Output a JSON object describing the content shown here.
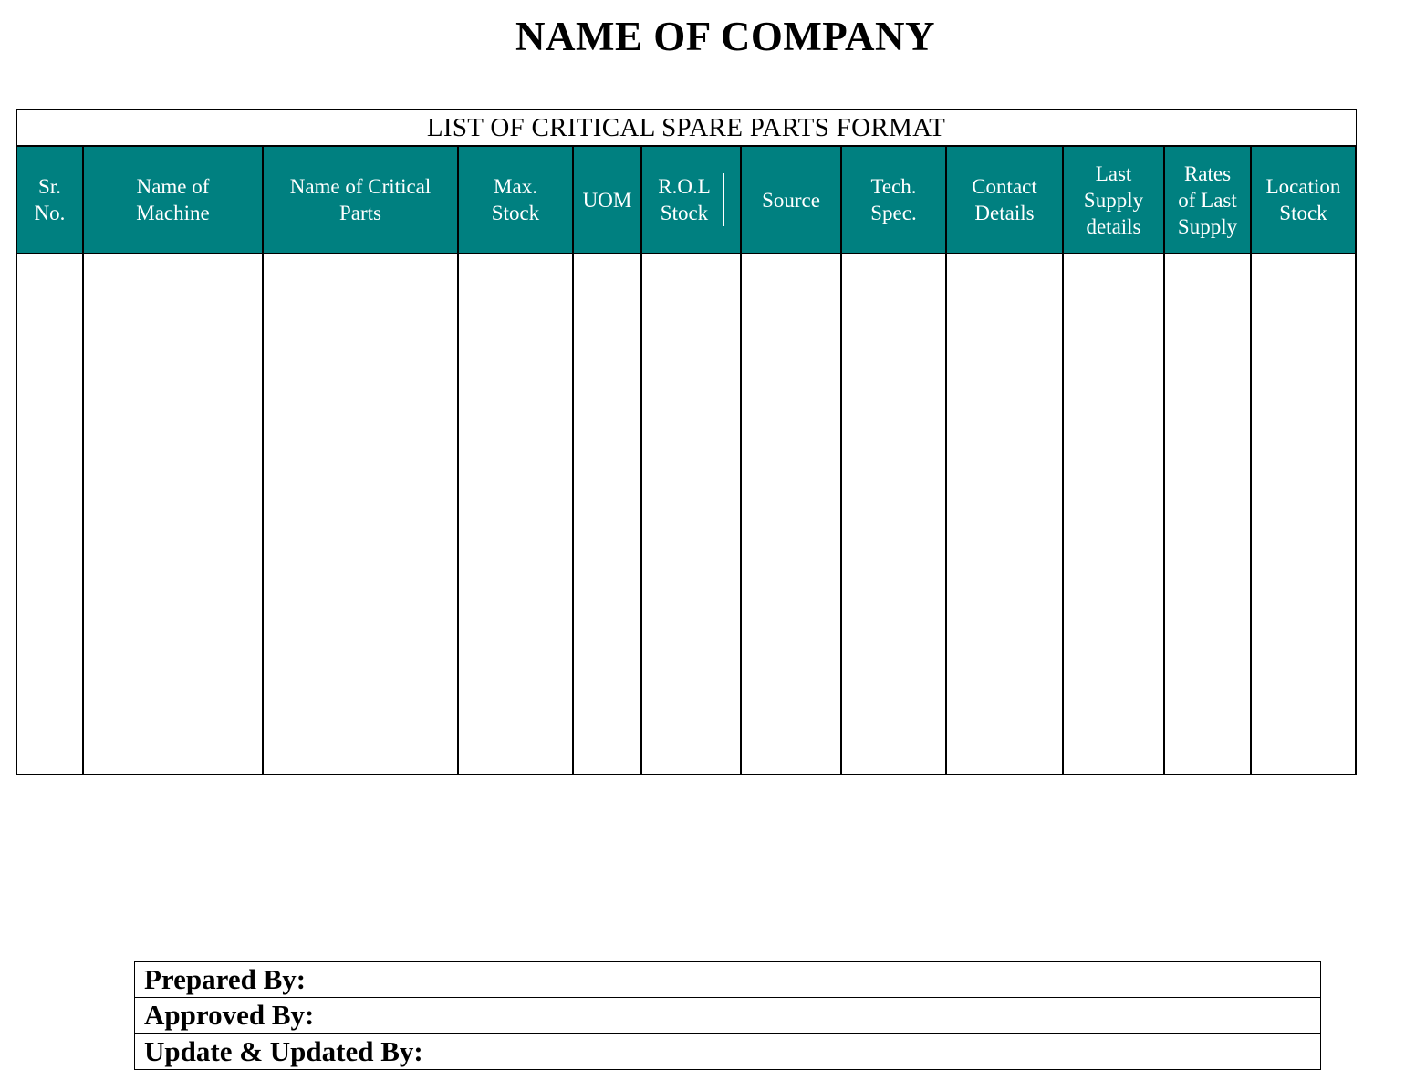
{
  "document": {
    "company_name": "NAME OF COMPANY",
    "table_title": "LIST OF CRITICAL SPARE PARTS FORMAT"
  },
  "table": {
    "columns": [
      {
        "line1": "Sr.",
        "line2": "No.",
        "line3": ""
      },
      {
        "line1": "Name of",
        "line2": "Machine",
        "line3": ""
      },
      {
        "line1": "Name of Critical",
        "line2": "Parts",
        "line3": ""
      },
      {
        "line1": "Max.",
        "line2": "Stock",
        "line3": ""
      },
      {
        "line1": "UOM",
        "line2": "",
        "line3": ""
      },
      {
        "line1": "R.O.L",
        "line2": "Stock",
        "line3": ""
      },
      {
        "line1": "Source",
        "line2": "",
        "line3": ""
      },
      {
        "line1": "Tech.",
        "line2": "Spec.",
        "line3": ""
      },
      {
        "line1": "Contact",
        "line2": "Details",
        "line3": ""
      },
      {
        "line1": "Last",
        "line2": "Supply",
        "line3": "details"
      },
      {
        "line1": "Rates",
        "line2": "of Last",
        "line3": "Supply"
      },
      {
        "line1": "Location",
        "line2": "Stock",
        "line3": ""
      }
    ],
    "rows": [
      [
        "",
        "",
        "",
        "",
        "",
        "",
        "",
        "",
        "",
        "",
        "",
        ""
      ],
      [
        "",
        "",
        "",
        "",
        "",
        "",
        "",
        "",
        "",
        "",
        "",
        ""
      ],
      [
        "",
        "",
        "",
        "",
        "",
        "",
        "",
        "",
        "",
        "",
        "",
        ""
      ],
      [
        "",
        "",
        "",
        "",
        "",
        "",
        "",
        "",
        "",
        "",
        "",
        ""
      ],
      [
        "",
        "",
        "",
        "",
        "",
        "",
        "",
        "",
        "",
        "",
        "",
        ""
      ],
      [
        "",
        "",
        "",
        "",
        "",
        "",
        "",
        "",
        "",
        "",
        "",
        ""
      ],
      [
        "",
        "",
        "",
        "",
        "",
        "",
        "",
        "",
        "",
        "",
        "",
        ""
      ],
      [
        "",
        "",
        "",
        "",
        "",
        "",
        "",
        "",
        "",
        "",
        "",
        ""
      ],
      [
        "",
        "",
        "",
        "",
        "",
        "",
        "",
        "",
        "",
        "",
        "",
        ""
      ],
      [
        "",
        "",
        "",
        "",
        "",
        "",
        "",
        "",
        "",
        "",
        "",
        ""
      ]
    ],
    "header_color": "#008080"
  },
  "footer": {
    "prepared_by": "Prepared By:",
    "approved_by": "Approved By:",
    "updated_by": "Update & Updated By:"
  }
}
